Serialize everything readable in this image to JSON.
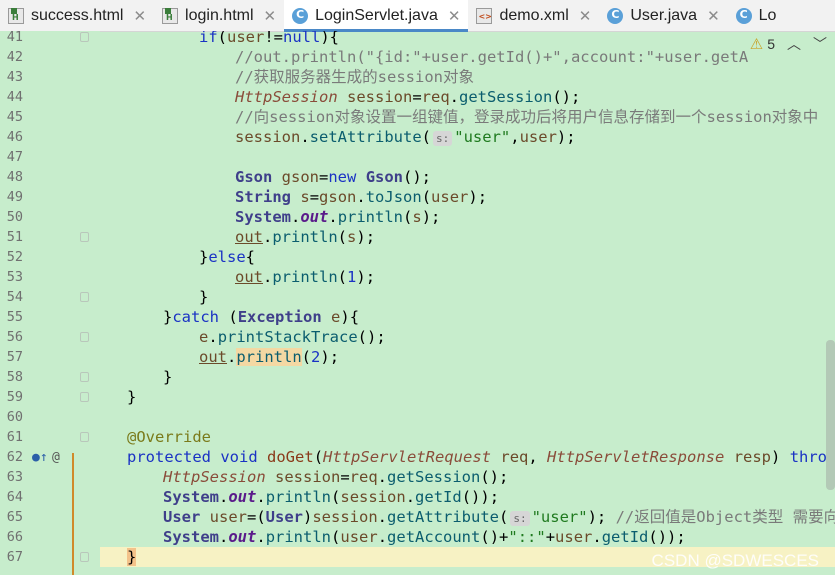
{
  "tabs": [
    {
      "label": "success.html",
      "icon": "html-file-icon",
      "active": false
    },
    {
      "label": "login.html",
      "icon": "html-file-icon",
      "active": false
    },
    {
      "label": "LoginServlet.java",
      "icon": "java-class-icon",
      "active": true
    },
    {
      "label": "demo.xml",
      "icon": "xml-file-icon",
      "active": false
    },
    {
      "label": "User.java",
      "icon": "java-class-icon",
      "active": false
    },
    {
      "label": "Lo",
      "icon": "java-class-icon",
      "active": false
    }
  ],
  "warnings": {
    "count": "5"
  },
  "watermark": "CSDN @SDWESCES",
  "lines": [
    {
      "n": "41",
      "text": "if(user!=null){"
    },
    {
      "n": "42",
      "text": "//out.println(\"{id:\"+user.getId()+\",account:\"+user.getA"
    },
    {
      "n": "43",
      "text": "//获取服务器生成的session对象"
    },
    {
      "n": "44",
      "text": "HttpSession session=req.getSession();"
    },
    {
      "n": "45",
      "text": "//向session对象设置一组键值，登录成功后将用户信息存储到一个session对象中"
    },
    {
      "n": "46",
      "text": "session.setAttribute( \"user\",user);"
    },
    {
      "n": "47",
      "text": ""
    },
    {
      "n": "48",
      "text": "Gson gson=new Gson();"
    },
    {
      "n": "49",
      "text": "String s=gson.toJson(user);"
    },
    {
      "n": "50",
      "text": "System.out.println(s);"
    },
    {
      "n": "51",
      "text": "out.println(s);"
    },
    {
      "n": "52",
      "text": "}else{"
    },
    {
      "n": "53",
      "text": "out.println(1);"
    },
    {
      "n": "54",
      "text": "}"
    },
    {
      "n": "55",
      "text": "}catch (Exception e){"
    },
    {
      "n": "56",
      "text": "e.printStackTrace();"
    },
    {
      "n": "57",
      "text": "out.println(2);"
    },
    {
      "n": "58",
      "text": "}"
    },
    {
      "n": "59",
      "text": "}"
    },
    {
      "n": "60",
      "text": ""
    },
    {
      "n": "61",
      "text": "@Override"
    },
    {
      "n": "62",
      "text": "protected void doGet(HttpServletRequest req, HttpServletResponse resp) throws"
    },
    {
      "n": "63",
      "text": "HttpSession session=req.getSession();"
    },
    {
      "n": "64",
      "text": "System.out.println(session.getId());"
    },
    {
      "n": "65",
      "text": "User user=(User)session.getAttribute( \"user\"); //返回值是Object类型 需要向下"
    },
    {
      "n": "66",
      "text": "System.out.println(user.getAccount()+\"::\"+user.getId());"
    },
    {
      "n": "67",
      "text": "}"
    }
  ],
  "hints": {
    "param_label": "s:"
  }
}
